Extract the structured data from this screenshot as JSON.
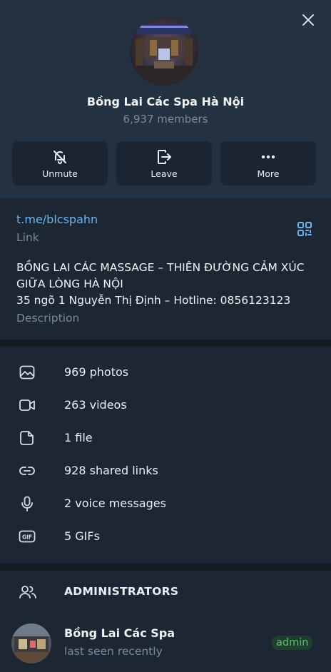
{
  "group": {
    "name": "Bồng Lai Các Spa Hà Nội",
    "members": "6,937 members"
  },
  "actions": [
    {
      "label": "Unmute",
      "icon": "bell-off-icon"
    },
    {
      "label": "Leave",
      "icon": "leave-icon"
    },
    {
      "label": "More",
      "icon": "more-dots-icon"
    }
  ],
  "info": {
    "link": "t.me/blcspahn",
    "link_label": "Link",
    "description_lines": [
      "BỒNG LAI CÁC MASSAGE – THIÊN ĐƯỜNG CẢM XÚC",
      "GIỮA LÒNG HÀ NỘI",
      "35 ngõ 1 Nguyễn Thị Định – Hotline: 0856123123"
    ],
    "description_label": "Description"
  },
  "media": [
    {
      "label": "969 photos",
      "icon": "photo-icon"
    },
    {
      "label": "263 videos",
      "icon": "video-icon"
    },
    {
      "label": "1 file",
      "icon": "file-icon"
    },
    {
      "label": "928 shared links",
      "icon": "link-icon"
    },
    {
      "label": "2 voice messages",
      "icon": "microphone-icon"
    },
    {
      "label": "5 GIFs",
      "icon": "gif-icon"
    }
  ],
  "admins": {
    "title": "ADMINISTRATORS",
    "list": [
      {
        "name": "Bồng Lai Các Spa",
        "status": "last seen recently",
        "badge": "admin"
      }
    ]
  },
  "colors": {
    "background": "#1c2733",
    "header": "#243140",
    "accent": "#6fb3f0",
    "muted": "#7a8a9c",
    "admin_badge": "#55c46d"
  }
}
